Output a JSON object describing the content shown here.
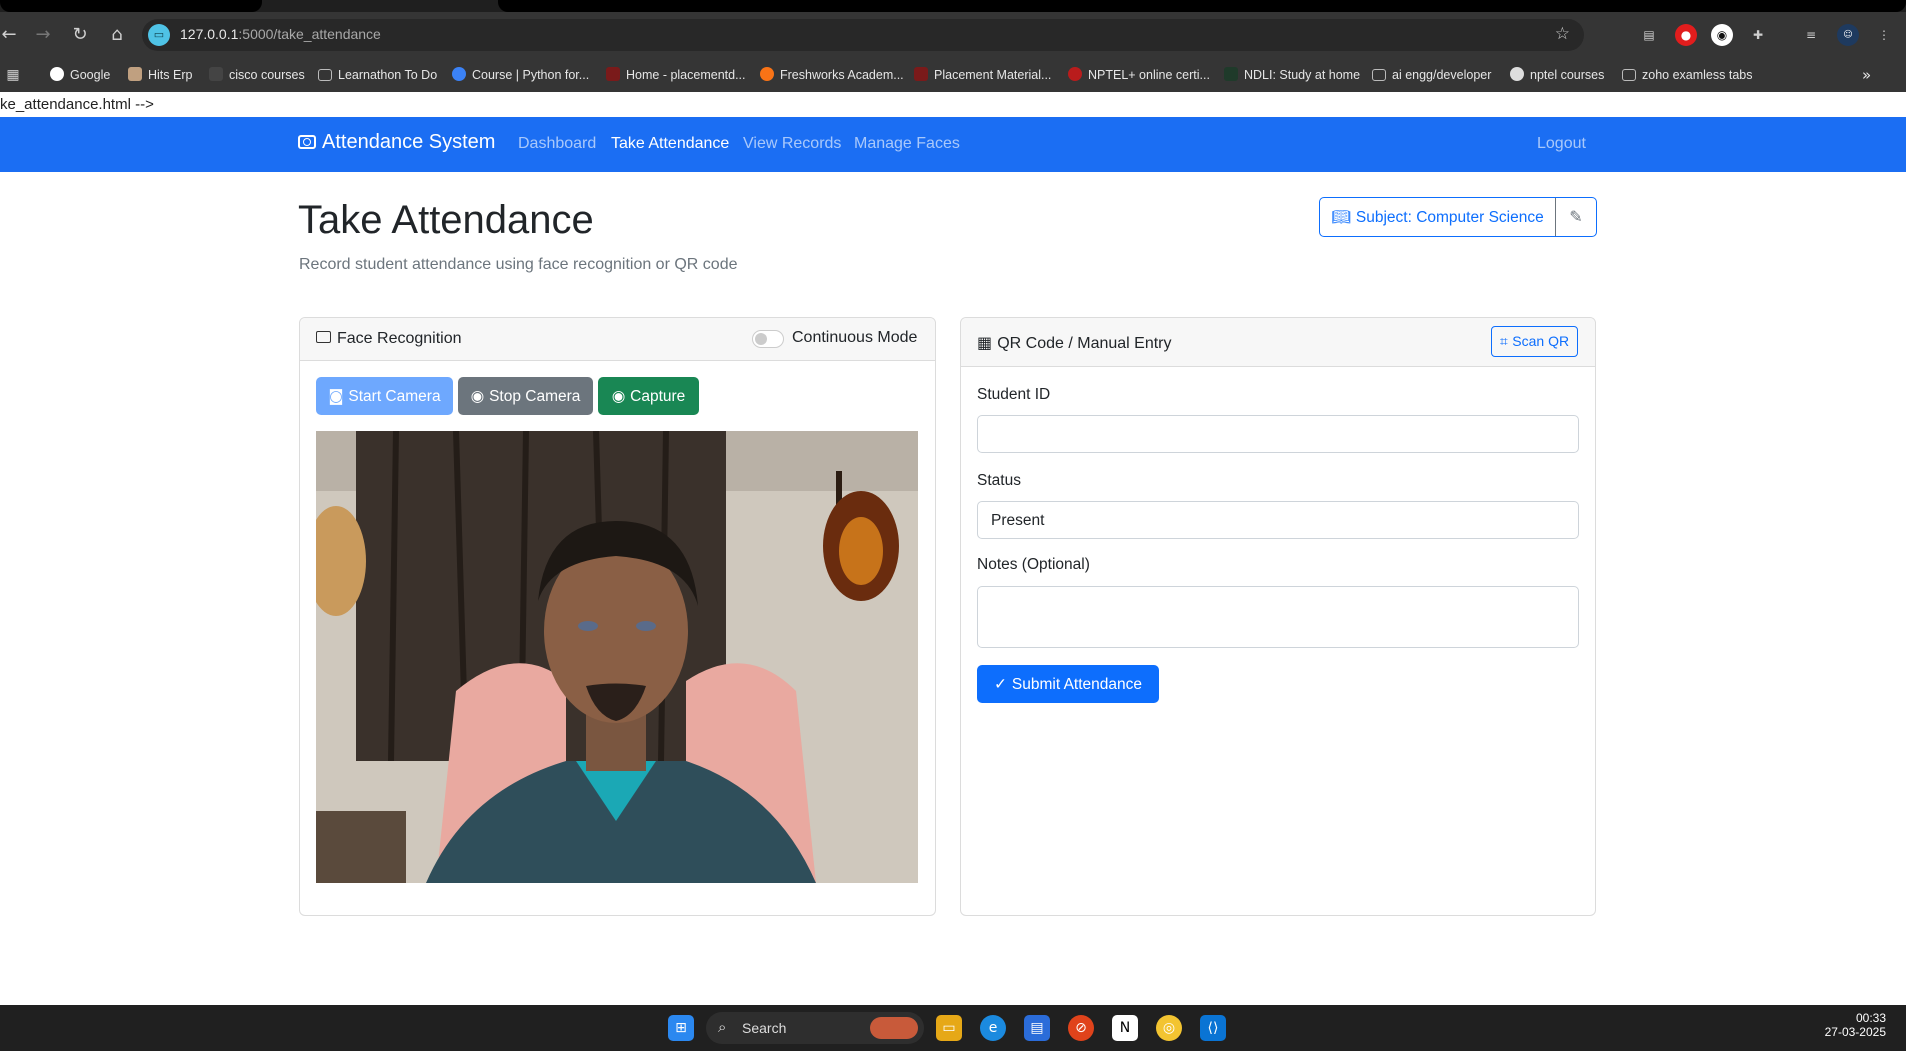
{
  "browser": {
    "url_host": "127.0.0.1",
    "url_path": ":5000/take_attendance",
    "bookmarks": [
      {
        "label": "Google",
        "color": "#ffffff"
      },
      {
        "label": "Hits Erp",
        "color": "#c0a080"
      },
      {
        "label": "cisco courses",
        "color": "#444444"
      },
      {
        "label": "Learnathon To Do",
        "color": "#999999"
      },
      {
        "label": "Course | Python for...",
        "color": "#3b82f6"
      },
      {
        "label": "Home - placementd...",
        "color": "#7a1a1a"
      },
      {
        "label": "Freshworks Academ...",
        "color": "#f97316"
      },
      {
        "label": "Placement Material...",
        "color": "#7a1a1a"
      },
      {
        "label": "NPTEL+ online certi...",
        "color": "#b91c1c"
      },
      {
        "label": "NDLI: Study at home",
        "color": "#1f3a2a"
      },
      {
        "label": "ai engg/developer",
        "color": "#999999"
      },
      {
        "label": "nptel courses",
        "color": "#dddddd"
      },
      {
        "label": "zoho examless tabs",
        "color": "#999999"
      }
    ]
  },
  "page": {
    "comment_text": "ke_attendance.html -->",
    "navbar": {
      "brand": "Attendance System",
      "links": [
        "Dashboard",
        "Take Attendance",
        "View Records",
        "Manage Faces"
      ],
      "active": "Take Attendance",
      "logout": "Logout",
      "color": "#1b6ef3"
    },
    "title": "Take Attendance",
    "subtitle": "Record student attendance using face recognition or QR code",
    "subject_button": "Subject: Computer Science",
    "face_card": {
      "title": "Face Recognition",
      "toggle_label": "Continuous Mode",
      "toggle_on": false,
      "start_camera": "Start Camera",
      "stop_camera": "Stop Camera",
      "capture": "Capture"
    },
    "qr_card": {
      "title": "QR Code / Manual Entry",
      "scan_button": "Scan QR",
      "student_id_label": "Student ID",
      "student_id_value": "",
      "status_label": "Status",
      "status_value": "Present",
      "notes_label": "Notes (Optional)",
      "notes_value": "",
      "submit": "Submit Attendance"
    }
  },
  "taskbar": {
    "search_placeholder": "Search",
    "time": "00:33",
    "date": "27-03-2025"
  }
}
